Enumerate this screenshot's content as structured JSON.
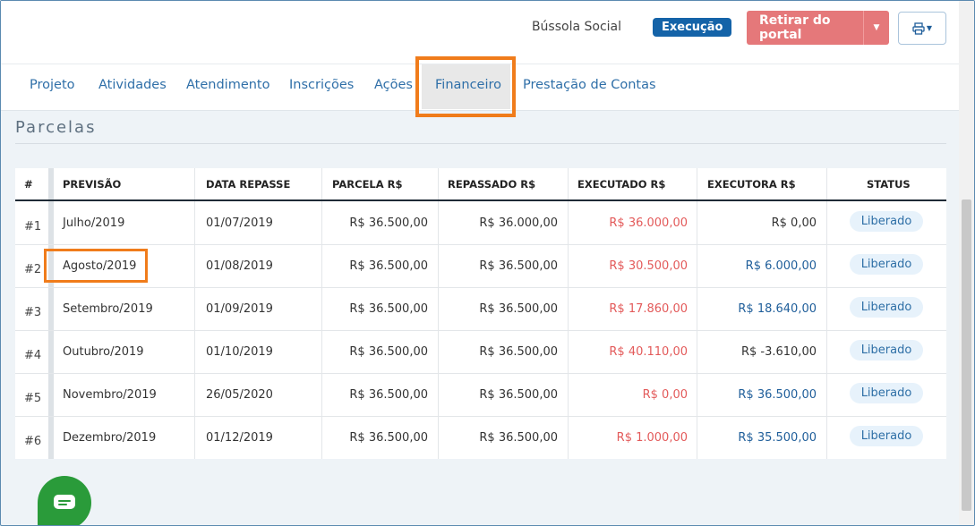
{
  "header": {
    "brand": "Bússola Social",
    "status_badge": "Execução",
    "retirar_label": "Retirar do portal",
    "colors": {
      "badge": "#1463a8",
      "retirar": "#e5787a",
      "accent": "#f07c1b"
    }
  },
  "tabs": [
    {
      "label": "Projeto"
    },
    {
      "label": "Atividades"
    },
    {
      "label": "Atendimento"
    },
    {
      "label": "Inscrições"
    },
    {
      "label": "Ações"
    },
    {
      "label": "Financeiro",
      "active": true
    },
    {
      "label": "Prestação de Contas"
    }
  ],
  "section": {
    "title": "Parcelas"
  },
  "table": {
    "headers": [
      "#",
      "PREVISÃO",
      "DATA REPASSE",
      "PARCELA R$",
      "REPASSADO R$",
      "EXECUTADO R$",
      "EXECUTORA R$",
      "STATUS"
    ],
    "rows": [
      {
        "n": "#1",
        "previsao": "Julho/2019",
        "data": "01/07/2019",
        "parcela": "R$ 36.500,00",
        "repassado": "R$ 36.000,00",
        "executado": "R$ 36.000,00",
        "executora": "R$ 0,00",
        "status": "Liberado"
      },
      {
        "n": "#2",
        "previsao": "Agosto/2019",
        "data": "01/08/2019",
        "parcela": "R$ 36.500,00",
        "repassado": "R$ 36.500,00",
        "executado": "R$ 30.500,00",
        "executora": "R$ 6.000,00",
        "status": "Liberado"
      },
      {
        "n": "#3",
        "previsao": "Setembro/2019",
        "data": "01/09/2019",
        "parcela": "R$ 36.500,00",
        "repassado": "R$ 36.500,00",
        "executado": "R$ 17.860,00",
        "executora": "R$ 18.640,00",
        "status": "Liberado"
      },
      {
        "n": "#4",
        "previsao": "Outubro/2019",
        "data": "01/10/2019",
        "parcela": "R$ 36.500,00",
        "repassado": "R$ 36.500,00",
        "executado": "R$ 40.110,00",
        "executora": "R$ -3.610,00",
        "status": "Liberado"
      },
      {
        "n": "#5",
        "previsao": "Novembro/2019",
        "data": "26/05/2020",
        "parcela": "R$ 36.500,00",
        "repassado": "R$ 36.500,00",
        "executado": "R$ 0,00",
        "executora": "R$ 36.500,00",
        "status": "Liberado"
      },
      {
        "n": "#6",
        "previsao": "Dezembro/2019",
        "data": "01/12/2019",
        "parcela": "R$ 36.500,00",
        "repassado": "R$ 36.500,00",
        "executado": "R$ 1.000,00",
        "executora": "R$ 35.500,00",
        "status": "Liberado"
      }
    ]
  },
  "icons": {
    "print": "printer-icon",
    "chat": "chat-icon"
  }
}
